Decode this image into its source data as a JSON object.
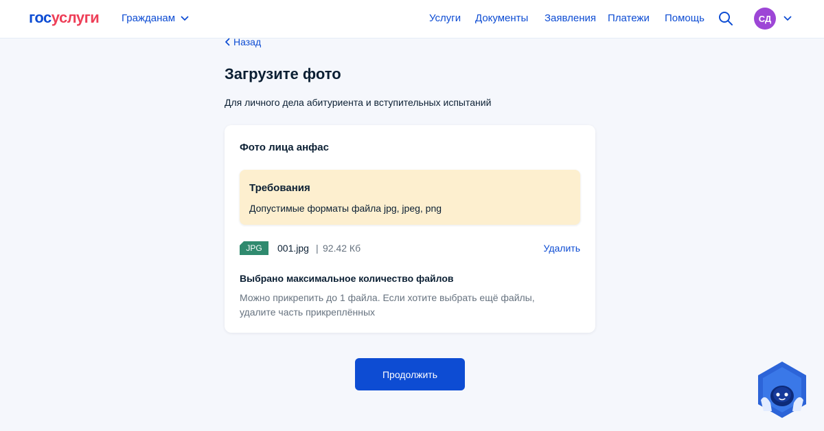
{
  "header": {
    "logo_part1": "гос",
    "logo_part2": "услуги",
    "audience": "Гражданам",
    "nav": [
      "Услуги",
      "Документы",
      "Заявления",
      "Платежи",
      "Помощь"
    ],
    "avatar_initials": "СД",
    "icons": {
      "search": "search-icon",
      "chevron": "chevron-down-icon"
    }
  },
  "page": {
    "back": "Назад",
    "title": "Загрузите фото",
    "subtitle": "Для личного дела абитуриента и вступительных испытаний"
  },
  "card": {
    "title": "Фото лица анфас",
    "requirements": {
      "title": "Требования",
      "text": "Допустимые форматы файла jpg, jpeg, png"
    },
    "file": {
      "type_badge": "JPG",
      "name": "001.jpg",
      "separator": "|",
      "size": "92.42 Кб",
      "delete_label": "Удалить"
    },
    "limit": {
      "title": "Выбрано максимальное количество файлов",
      "text": "Можно прикрепить до 1 файла. Если хотите выбрать ещё файлы, удалите часть прикреплённых"
    }
  },
  "actions": {
    "continue": "Продолжить"
  },
  "colors": {
    "accent": "#0d4cd3",
    "logo_red": "#ee3f58",
    "avatar": "#9d46d6",
    "requirements_bg": "#fdefcf",
    "file_badge": "#2f8a6e",
    "background": "#f5f7fc"
  },
  "assistant": {
    "icon": "robot-assistant-icon"
  }
}
